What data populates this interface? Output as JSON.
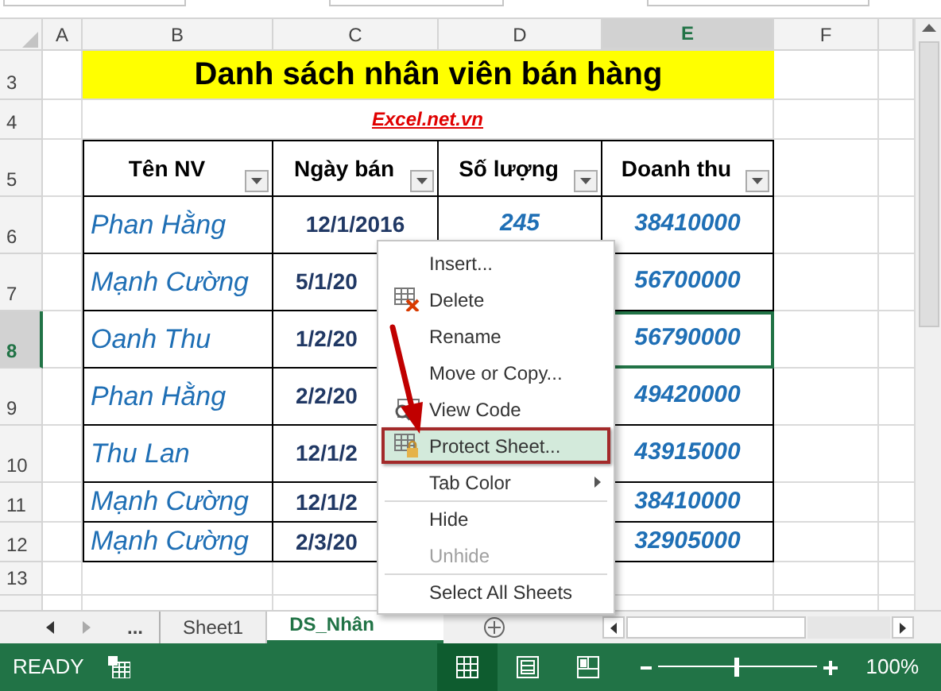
{
  "column_headers": [
    {
      "label": "A",
      "selected": false
    },
    {
      "label": "B",
      "selected": false
    },
    {
      "label": "C",
      "selected": false
    },
    {
      "label": "D",
      "selected": false
    },
    {
      "label": "E",
      "selected": true
    },
    {
      "label": "F",
      "selected": false
    }
  ],
  "row_headers": [
    {
      "label": "3",
      "selected": false
    },
    {
      "label": "4",
      "selected": false
    },
    {
      "label": "5",
      "selected": false
    },
    {
      "label": "6",
      "selected": false
    },
    {
      "label": "7",
      "selected": false
    },
    {
      "label": "8",
      "selected": true
    },
    {
      "label": "9",
      "selected": false
    },
    {
      "label": "10",
      "selected": false
    },
    {
      "label": "11",
      "selected": false
    },
    {
      "label": "12",
      "selected": false
    },
    {
      "label": "13",
      "selected": false
    }
  ],
  "title": "Danh sách nhân viên bán hàng",
  "link": "Excel.net.vn",
  "table": {
    "columns": [
      "Tên NV",
      "Ngày bán",
      "Số lượng",
      "Doanh thu"
    ],
    "rows": [
      {
        "name": "Phan Hằng",
        "date": "12/1/2016",
        "quantity": "245",
        "revenue": "38410000",
        "selected": false
      },
      {
        "name": "Mạnh Cường",
        "date": "5/1/20",
        "revenue": "56700000",
        "selected": false
      },
      {
        "name": "Oanh Thu",
        "date": "1/2/20",
        "revenue": "56790000",
        "selected": true
      },
      {
        "name": "Phan Hằng",
        "date": "2/2/20",
        "revenue": "49420000",
        "selected": false
      },
      {
        "name": "Thu Lan",
        "date": "12/1/2",
        "revenue": "43915000",
        "selected": false
      },
      {
        "name": "Mạnh Cường",
        "date": "12/1/2",
        "revenue": "38410000",
        "selected": false
      },
      {
        "name": "Mạnh Cường",
        "date": "2/3/20",
        "revenue": "32905000",
        "selected": false
      }
    ]
  },
  "context_menu": [
    {
      "label": "Insert...",
      "disabled": false,
      "highlighted": false,
      "submenu": false,
      "group_start": false
    },
    {
      "label": "Delete",
      "disabled": false,
      "highlighted": false,
      "submenu": false,
      "group_start": false
    },
    {
      "label": "Rename",
      "disabled": false,
      "highlighted": false,
      "submenu": false,
      "group_start": false
    },
    {
      "label": "Move or Copy...",
      "disabled": false,
      "highlighted": false,
      "submenu": false,
      "group_start": false
    },
    {
      "label": "View Code",
      "disabled": false,
      "highlighted": false,
      "submenu": false,
      "group_start": false
    },
    {
      "label": "Protect Sheet...",
      "disabled": false,
      "highlighted": true,
      "submenu": false,
      "group_start": false
    },
    {
      "label": "Tab Color",
      "disabled": false,
      "highlighted": false,
      "submenu": true,
      "group_start": false
    },
    {
      "label": "Hide",
      "disabled": false,
      "highlighted": false,
      "submenu": false,
      "group_start": true
    },
    {
      "label": "Unhide",
      "disabled": true,
      "highlighted": false,
      "submenu": false,
      "group_start": false
    },
    {
      "label": "Select All Sheets",
      "disabled": false,
      "highlighted": false,
      "submenu": false,
      "group_start": true
    }
  ],
  "sheet_tabs": [
    {
      "label": "...",
      "selected": false
    },
    {
      "label": "Sheet1",
      "selected": false
    },
    {
      "label": "DS_Nhân",
      "selected": true
    }
  ],
  "status_bar": {
    "mode": "READY",
    "zoom": "100%",
    "level": 0.5,
    "views": [
      {
        "selected": true
      },
      {
        "selected": false
      },
      {
        "selected": false
      }
    ]
  }
}
